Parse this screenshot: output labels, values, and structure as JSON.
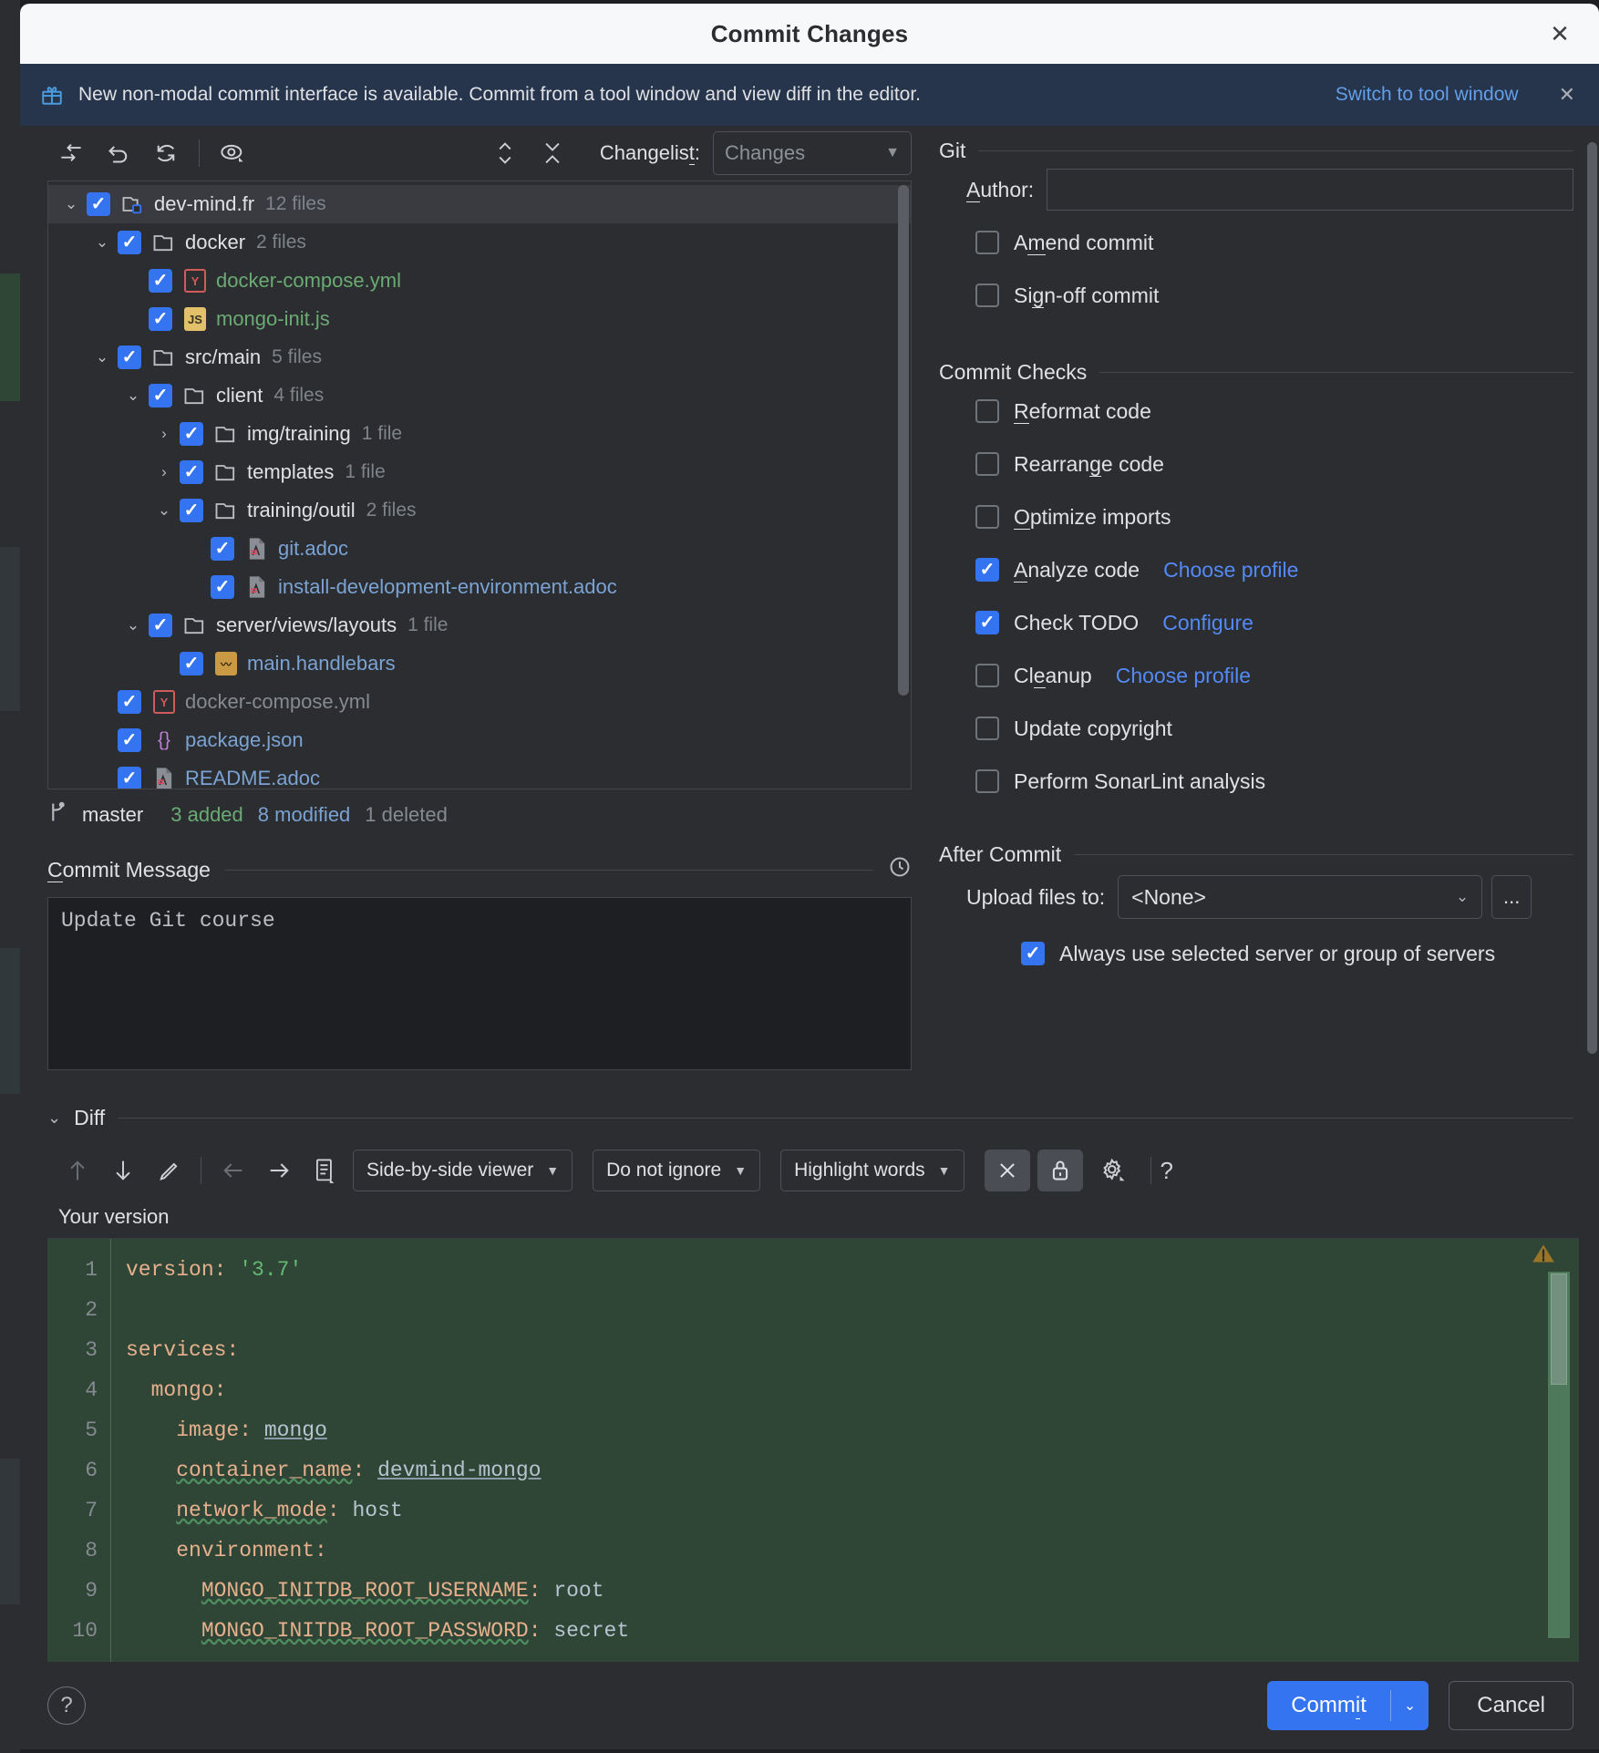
{
  "window": {
    "title": "Commit Changes",
    "close_icon": "close-icon"
  },
  "banner": {
    "icon": "gift-icon",
    "text": "New non-modal commit interface is available. Commit from a tool window and view diff in the editor.",
    "link": "Switch to tool window",
    "close_icon": "close-icon"
  },
  "tree_toolbar": {
    "icons": [
      "move-to-another-changelist-icon",
      "revert-icon",
      "refresh-icon",
      "show-diff-preview-icon",
      "expand-collapse-icon",
      "collapse-all-icon"
    ],
    "changelist_label": "Changelist:",
    "changelist_value": "Changes"
  },
  "tree": [
    {
      "level": 0,
      "twisty": "down",
      "checked": true,
      "icon": "module-icon",
      "name": "dev-mind.fr",
      "count": "12 files",
      "style": "dir",
      "selected": true
    },
    {
      "level": 1,
      "twisty": "down",
      "checked": true,
      "icon": "folder-icon",
      "name": "docker",
      "count": "2 files",
      "style": "dir",
      "selected": false
    },
    {
      "level": 2,
      "twisty": "none",
      "checked": true,
      "icon": "yml-icon",
      "name": "docker-compose.yml",
      "count": "",
      "style": "added",
      "selected": false
    },
    {
      "level": 2,
      "twisty": "none",
      "checked": true,
      "icon": "js-icon",
      "name": "mongo-init.js",
      "count": "",
      "style": "added",
      "selected": false
    },
    {
      "level": 1,
      "twisty": "down",
      "checked": true,
      "icon": "folder-icon",
      "name": "src/main",
      "count": "5 files",
      "style": "dir",
      "selected": false
    },
    {
      "level": 2,
      "twisty": "down",
      "checked": true,
      "icon": "folder-icon",
      "name": "client",
      "count": "4 files",
      "style": "dir",
      "selected": false
    },
    {
      "level": 3,
      "twisty": "right",
      "checked": true,
      "icon": "folder-icon",
      "name": "img/training",
      "count": "1 file",
      "style": "dir",
      "selected": false
    },
    {
      "level": 3,
      "twisty": "right",
      "checked": true,
      "icon": "folder-icon",
      "name": "templates",
      "count": "1 file",
      "style": "dir",
      "selected": false
    },
    {
      "level": 3,
      "twisty": "down",
      "checked": true,
      "icon": "folder-icon",
      "name": "training/outil",
      "count": "2 files",
      "style": "dir",
      "selected": false
    },
    {
      "level": 4,
      "twisty": "none",
      "checked": true,
      "icon": "adoc-icon",
      "name": "git.adoc",
      "count": "",
      "style": "modified",
      "selected": false
    },
    {
      "level": 4,
      "twisty": "none",
      "checked": true,
      "icon": "adoc-icon",
      "name": "install-development-environment.adoc",
      "count": "",
      "style": "modified",
      "selected": false
    },
    {
      "level": 2,
      "twisty": "down",
      "checked": true,
      "icon": "folder-icon",
      "name": "server/views/layouts",
      "count": "1 file",
      "style": "dir",
      "selected": false
    },
    {
      "level": 3,
      "twisty": "none",
      "checked": true,
      "icon": "hbs-icon",
      "name": "main.handlebars",
      "count": "",
      "style": "modified",
      "selected": false
    },
    {
      "level": 1,
      "twisty": "none",
      "checked": true,
      "icon": "yml-icon",
      "name": "docker-compose.yml",
      "count": "",
      "style": "deleted",
      "selected": false
    },
    {
      "level": 1,
      "twisty": "none",
      "checked": true,
      "icon": "json-icon",
      "name": "package.json",
      "count": "",
      "style": "modified",
      "selected": false
    },
    {
      "level": 1,
      "twisty": "none",
      "checked": true,
      "icon": "adoc-icon",
      "name": "README.adoc",
      "count": "",
      "style": "modified",
      "selected": false
    }
  ],
  "branch_status": {
    "icon": "branch-icon",
    "branch": "master",
    "added": "3 added",
    "modified": "8 modified",
    "deleted": "1 deleted"
  },
  "commit_message": {
    "label": "Commit Message",
    "history_icon": "clock-icon",
    "value": "Update Git course"
  },
  "git_section": {
    "title": "Git",
    "author_label": "Author:",
    "author_value": "",
    "checkboxes": [
      {
        "label": "Amend commit",
        "checked": false
      },
      {
        "label": "Sign-off commit",
        "checked": false
      }
    ]
  },
  "commit_checks": {
    "title": "Commit Checks",
    "items": [
      {
        "label": "Reformat code",
        "checked": false,
        "link": ""
      },
      {
        "label": "Rearrange code",
        "checked": false,
        "link": ""
      },
      {
        "label": "Optimize imports",
        "checked": false,
        "link": ""
      },
      {
        "label": "Analyze code",
        "checked": true,
        "link": "Choose profile"
      },
      {
        "label": "Check TODO",
        "checked": true,
        "link": "Configure"
      },
      {
        "label": "Cleanup",
        "checked": false,
        "link": "Choose profile"
      },
      {
        "label": "Update copyright",
        "checked": false,
        "link": ""
      },
      {
        "label": "Perform SonarLint analysis",
        "checked": false,
        "link": ""
      }
    ]
  },
  "after_commit": {
    "title": "After Commit",
    "upload_label": "Upload files to:",
    "upload_value": "<None>",
    "dots_label": "...",
    "always_use": {
      "label": "Always use selected server or group of servers",
      "checked": true
    }
  },
  "diff": {
    "title": "Diff",
    "toolbar": {
      "prev_icon": "arrow-up-icon",
      "next_icon": "arrow-down-icon",
      "edit_icon": "pencil-icon",
      "accept_left_icon": "arrow-left-icon",
      "accept_right_icon": "arrow-right-icon",
      "lines_icon": "editor-settings-icon",
      "viewer_mode": "Side-by-side viewer",
      "ignore_mode": "Do not ignore",
      "highlight_mode": "Highlight words",
      "collapse_icon": "collapse-unchanged-icon",
      "lock_icon": "lock-icon",
      "gear_icon": "gear-icon",
      "help_icon": "question-icon"
    },
    "version_label": "Your version",
    "warn_icon": "warning-icon",
    "code_lines": [
      {
        "n": "1",
        "text": "version: '3.7'"
      },
      {
        "n": "2",
        "text": ""
      },
      {
        "n": "3",
        "text": "services:"
      },
      {
        "n": "4",
        "text": "  mongo:"
      },
      {
        "n": "5",
        "text": "    image: mongo"
      },
      {
        "n": "6",
        "text": "    container_name: devmind-mongo"
      },
      {
        "n": "7",
        "text": "    network_mode: host"
      },
      {
        "n": "8",
        "text": "    environment:"
      },
      {
        "n": "9",
        "text": "      MONGO_INITDB_ROOT_USERNAME: root"
      },
      {
        "n": "10",
        "text": "      MONGO_INITDB_ROOT_PASSWORD: secret"
      }
    ]
  },
  "buttons": {
    "help": "?",
    "commit": "Commit",
    "commit_dropdown_icon": "chevron-down-icon",
    "cancel": "Cancel"
  },
  "colors": {
    "accent": "#3574f0",
    "link": "#548af7",
    "added": "#6aab73",
    "modified": "#7aa3d4",
    "deleted": "#868a91",
    "banner_bg": "#26344c",
    "diff_bg": "#2f4636"
  }
}
